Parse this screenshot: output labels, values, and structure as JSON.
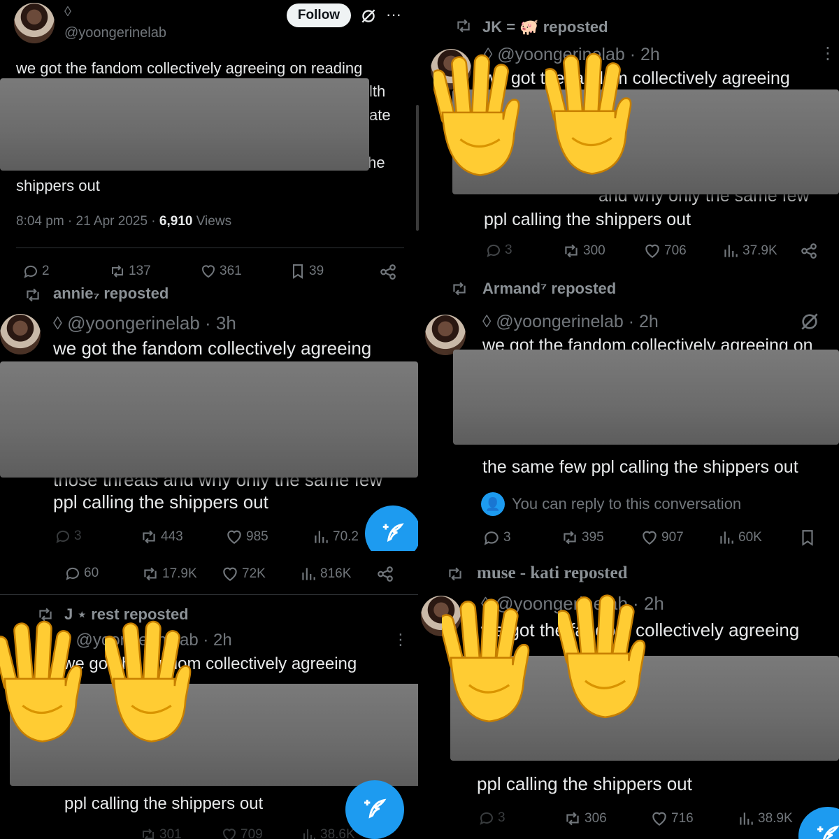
{
  "p1": {
    "badge": "◊",
    "handle": "@yoongerinelab",
    "follow": "Follow",
    "more": "···",
    "line1": "we got the fandom collectively agreeing on reading",
    "frag1": "lth",
    "frag2": "ate",
    "frag3": "the",
    "line_last": "shippers out",
    "time": "8:04 pm · 21 Apr 2025 · ",
    "views_num": "6,910",
    "views_word": " Views",
    "replies": "2",
    "reposts": "137",
    "likes": "361",
    "bookmarks": "39"
  },
  "p2": {
    "reposter": "JK = 🐖 reposted",
    "handle": "◊ @yoongerinelab · 2h",
    "line1": "we got the fandom collectively agreeing",
    "frag": "and why only the same few",
    "line_last": "ppl calling the shippers out",
    "replies": "3",
    "reposts": "300",
    "likes": "706",
    "views": "37.9K"
  },
  "p3": {
    "reposter": "annie₇ reposted",
    "handle": "◊ @yoongerinelab · 3h",
    "line1": "we got the fandom collectively agreeing",
    "frag": "those threats and why only the same few",
    "line_last": "ppl calling the shippers out",
    "replies": "3",
    "reposts": "443",
    "likes": "985",
    "views": "70.2"
  },
  "p4": {
    "reposter": "Armand⁷ reposted",
    "handle": "◊ @yoongerinelab · 2h",
    "line1": "we got the fandom collectively agreeing on",
    "line_last": "the same few ppl calling the shippers out",
    "reply_note": "You can reply to this conversation",
    "replies": "3",
    "reposts": "395",
    "likes": "907",
    "views": "60K"
  },
  "p5": {
    "replies": "60",
    "reposts": "17.9K",
    "likes": "72K",
    "views": "816K",
    "reposter": "J ⋆ rest reposted",
    "handle": "◊ @yoongerinelab · 2h",
    "line1": "we got the fandom collectively agreeing",
    "line_last": "ppl calling the shippers out",
    "bottom_reposts": "301",
    "bottom_likes": "709",
    "bottom_views": "38.6K"
  },
  "p6": {
    "reposter": "muse - kati reposted",
    "handle": "◊ @yoongerinelab · 2h",
    "line1": "we got the fandom collectively agreeing",
    "line_last": "ppl calling the shippers out",
    "replies": "3",
    "reposts": "306",
    "likes": "716",
    "views": "38.9K"
  },
  "icons": [
    "repost-icon",
    "reply-icon",
    "like-icon",
    "views-icon",
    "share-icon",
    "bookmark-icon",
    "compose-icon",
    "verified-off-icon",
    "reply-permission-icon",
    "raised-hands-emoji"
  ],
  "colors": {
    "background": "#000000",
    "text": "#e7e9ea",
    "muted": "#71767b",
    "accent": "#1d9bf0",
    "redaction": "#6f6f6f",
    "emoji": "#ffcc33"
  }
}
